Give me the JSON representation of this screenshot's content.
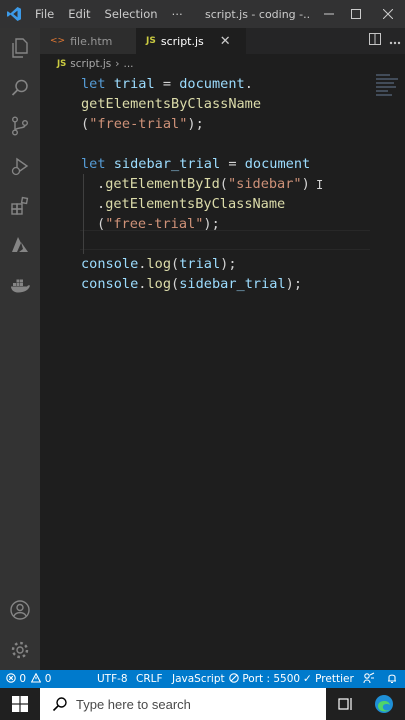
{
  "titlebar": {
    "menu": [
      "File",
      "Edit",
      "Selection",
      "⋯"
    ],
    "title": "script.js - coding -..."
  },
  "tabs": [
    {
      "icon": "<>",
      "label": "file.htm"
    },
    {
      "icon": "JS",
      "label": "script.js",
      "close": "✕"
    }
  ],
  "breadcrumb": {
    "icon": "JS",
    "file": "script.js",
    "sep": "›",
    "more": "..."
  },
  "code": {
    "l1": {
      "kw": "let",
      "var": "trial",
      "op": " = ",
      "obj": "document",
      "dot": "."
    },
    "l2": {
      "fn": "getElementsByClassName"
    },
    "l3": {
      "open": "(",
      "str": "\"free-trial\"",
      "close": ");"
    },
    "l5": {
      "kw": "let",
      "var": "sidebar_trial",
      "op": " = ",
      "obj": "document"
    },
    "l6": {
      "dot": ".",
      "fn": "getElementById",
      "open": "(",
      "str": "\"sidebar\"",
      "close": ")"
    },
    "l7": {
      "dot": ".",
      "fn": "getElementsByClassName"
    },
    "l8": {
      "open": "(",
      "str": "\"free-trial\"",
      "close": ");"
    },
    "l10": {
      "obj": "console",
      "dot": ".",
      "fn": "log",
      "open": "(",
      "arg": "trial",
      "close": ");"
    },
    "l11": {
      "obj": "console",
      "dot": ".",
      "fn": "log",
      "open": "(",
      "arg": "sidebar_trial",
      "close": ");"
    }
  },
  "status": {
    "errors": "0",
    "warnings": "0",
    "encoding": "UTF-8",
    "eol": "CRLF",
    "language": "JavaScript",
    "port": "Port : 5500",
    "prettier": "Prettier"
  },
  "taskbar": {
    "search_placeholder": "Type here to search"
  },
  "colors": {
    "accent": "#007acc",
    "keyword": "#569cd6",
    "string": "#ce9178",
    "function": "#dcdcaa",
    "variable": "#9cdcfe"
  }
}
